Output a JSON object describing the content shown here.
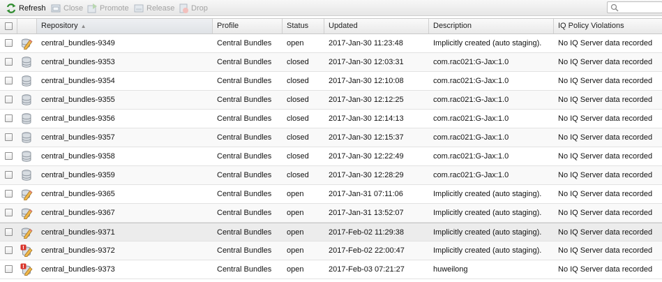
{
  "toolbar": {
    "refresh_label": "Refresh",
    "close_label": "Close",
    "promote_label": "Promote",
    "release_label": "Release",
    "drop_label": "Drop",
    "search_value": "",
    "search_placeholder": ""
  },
  "columns": {
    "repository": "Repository",
    "profile": "Profile",
    "status": "Status",
    "updated": "Updated",
    "description": "Description",
    "iq": "IQ Policy Violations"
  },
  "rows": [
    {
      "icon": "open-repo-icon",
      "repository": "central_bundles-9349",
      "profile": "Central Bundles",
      "status": "open",
      "updated": "2017-Jan-30 11:23:48",
      "description": "Implicitly created (auto staging).",
      "iq": "No IQ Server data recorded"
    },
    {
      "icon": "closed-repo-icon",
      "repository": "central_bundles-9353",
      "profile": "Central Bundles",
      "status": "closed",
      "updated": "2017-Jan-30 12:03:31",
      "description": "com.rac021:G-Jax:1.0",
      "iq": "No IQ Server data recorded"
    },
    {
      "icon": "closed-repo-icon",
      "repository": "central_bundles-9354",
      "profile": "Central Bundles",
      "status": "closed",
      "updated": "2017-Jan-30 12:10:08",
      "description": "com.rac021:G-Jax:1.0",
      "iq": "No IQ Server data recorded"
    },
    {
      "icon": "closed-repo-icon",
      "repository": "central_bundles-9355",
      "profile": "Central Bundles",
      "status": "closed",
      "updated": "2017-Jan-30 12:12:25",
      "description": "com.rac021:G-Jax:1.0",
      "iq": "No IQ Server data recorded"
    },
    {
      "icon": "closed-repo-icon",
      "repository": "central_bundles-9356",
      "profile": "Central Bundles",
      "status": "closed",
      "updated": "2017-Jan-30 12:14:13",
      "description": "com.rac021:G-Jax:1.0",
      "iq": "No IQ Server data recorded"
    },
    {
      "icon": "closed-repo-icon",
      "repository": "central_bundles-9357",
      "profile": "Central Bundles",
      "status": "closed",
      "updated": "2017-Jan-30 12:15:37",
      "description": "com.rac021:G-Jax:1.0",
      "iq": "No IQ Server data recorded"
    },
    {
      "icon": "closed-repo-icon",
      "repository": "central_bundles-9358",
      "profile": "Central Bundles",
      "status": "closed",
      "updated": "2017-Jan-30 12:22:49",
      "description": "com.rac021:G-Jax:1.0",
      "iq": "No IQ Server data recorded"
    },
    {
      "icon": "closed-repo-icon",
      "repository": "central_bundles-9359",
      "profile": "Central Bundles",
      "status": "closed",
      "updated": "2017-Jan-30 12:28:29",
      "description": "com.rac021:G-Jax:1.0",
      "iq": "No IQ Server data recorded"
    },
    {
      "icon": "open-repo-icon",
      "repository": "central_bundles-9365",
      "profile": "Central Bundles",
      "status": "open",
      "updated": "2017-Jan-31 07:11:06",
      "description": "Implicitly created (auto staging).",
      "iq": "No IQ Server data recorded"
    },
    {
      "icon": "open-repo-icon",
      "repository": "central_bundles-9367",
      "profile": "Central Bundles",
      "status": "open",
      "updated": "2017-Jan-31 13:52:07",
      "description": "Implicitly created (auto staging).",
      "iq": "No IQ Server data recorded"
    },
    {
      "icon": "open-repo-icon",
      "repository": "central_bundles-9371",
      "profile": "Central Bundles",
      "status": "open",
      "updated": "2017-Feb-02 11:29:38",
      "description": "Implicitly created (auto staging).",
      "iq": "No IQ Server data recorded"
    },
    {
      "icon": "error-repo-icon",
      "repository": "central_bundles-9372",
      "profile": "Central Bundles",
      "status": "open",
      "updated": "2017-Feb-02 22:00:47",
      "description": "Implicitly created (auto staging).",
      "iq": "No IQ Server data recorded"
    },
    {
      "icon": "error-repo-icon",
      "repository": "central_bundles-9373",
      "profile": "Central Bundles",
      "status": "open",
      "updated": "2017-Feb-03 07:21:27",
      "description": "huweilong",
      "iq": "No IQ Server data recorded"
    }
  ],
  "selected_row": 10,
  "colors": {
    "error_badge": "#d9342b",
    "pencil": "#e8a33a",
    "disk": "#9aa3ad"
  }
}
